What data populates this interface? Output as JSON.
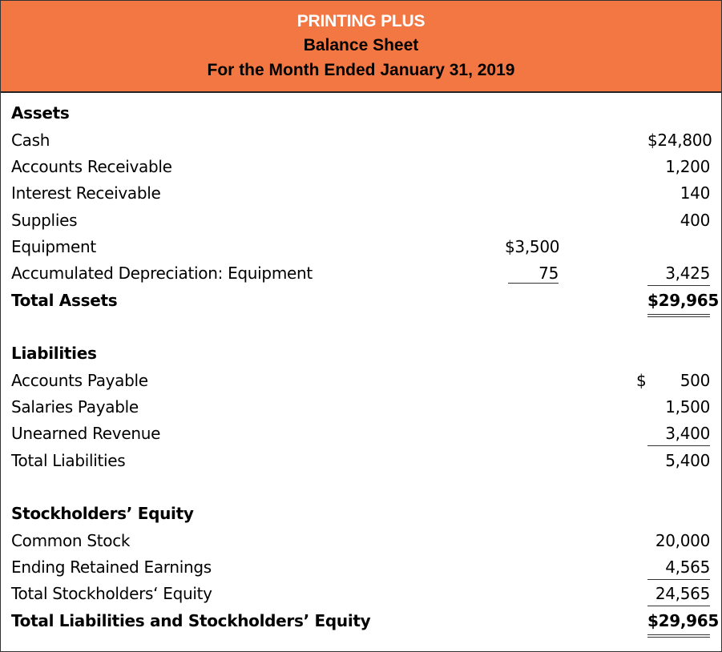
{
  "header": {
    "company": "PRINTING PLUS",
    "statement": "Balance Sheet",
    "period": "For the Month Ended January 31, 2019",
    "background_color": "#f27743"
  },
  "assets": {
    "heading": "Assets",
    "items": [
      {
        "label": "Cash",
        "amount": "$24,800"
      },
      {
        "label": "Accounts Receivable",
        "amount": "1,200"
      },
      {
        "label": "Interest Receivable",
        "amount": "140"
      },
      {
        "label": "Supplies",
        "amount": "400"
      },
      {
        "label": "Equipment",
        "inner": "$3,500"
      },
      {
        "label": "Accumulated Depreciation: Equipment",
        "inner": "75",
        "amount": "3,425"
      }
    ],
    "total": {
      "label": "Total Assets",
      "amount": "$29,965"
    }
  },
  "liabilities": {
    "heading": "Liabilities",
    "items": [
      {
        "label": "Accounts Payable",
        "currency": "$",
        "amount": "500"
      },
      {
        "label": "Salaries Payable",
        "amount": "1,500"
      },
      {
        "label": "Unearned Revenue",
        "amount": "3,400"
      }
    ],
    "total": {
      "label": "Total Liabilities",
      "amount": "5,400"
    }
  },
  "equity": {
    "heading": "Stockholders’ Equity",
    "items": [
      {
        "label": "Common Stock",
        "amount": "20,000"
      },
      {
        "label": "Ending Retained Earnings",
        "amount": "4,565"
      }
    ],
    "total": {
      "label": "Total Stockholders‘ Equity",
      "amount": "24,565"
    },
    "grand_total": {
      "label": "Total Liabilities and Stockholders’ Equity",
      "amount": "$29,965"
    }
  }
}
